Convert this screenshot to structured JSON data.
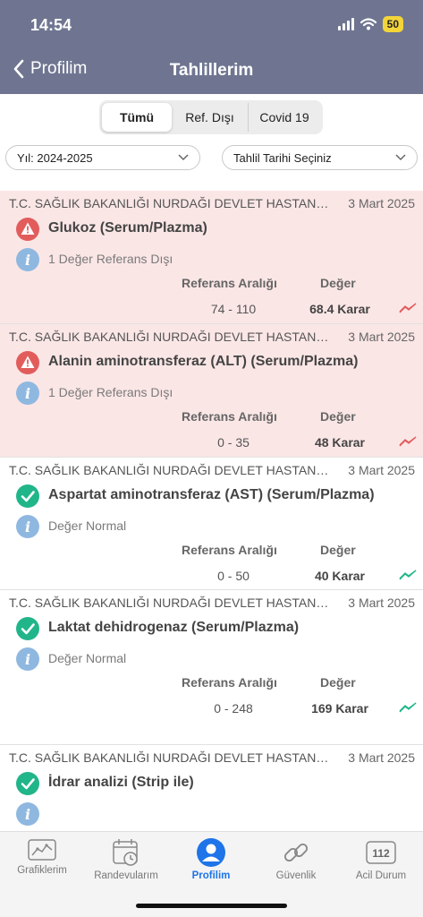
{
  "status_bar": {
    "time": "14:54",
    "battery": "50"
  },
  "nav": {
    "back_label": "Profilim",
    "title": "Tahlillerim"
  },
  "segments": [
    {
      "label": "Tümü",
      "active": true
    },
    {
      "label": "Ref. Dışı",
      "active": false
    },
    {
      "label": "Covid 19",
      "active": false
    }
  ],
  "filters": {
    "year": "Yıl: 2024-2025",
    "date": "Tahlil Tarihi Seçiniz"
  },
  "columns": {
    "ref": "Referans Aralığı",
    "value": "Değer"
  },
  "results": [
    {
      "hospital": "T.C. SAĞLIK BAKANLIĞI NURDAĞI DEVLET HASTANESİ",
      "date": "3 Mart 2025",
      "name": "Glukoz (Serum/Plazma)",
      "note": "1 Değer Referans Dışı",
      "ref_range": "74 - 110",
      "value": "68.4 Karar",
      "status": "out"
    },
    {
      "hospital": "T.C. SAĞLIK BAKANLIĞI NURDAĞI DEVLET HASTANESİ",
      "date": "3 Mart 2025",
      "name": "Alanin aminotransferaz (ALT) (Serum/Plazma)",
      "note": "1 Değer Referans Dışı",
      "ref_range": "0 - 35",
      "value": "48 Karar",
      "status": "out"
    },
    {
      "hospital": "T.C. SAĞLIK BAKANLIĞI NURDAĞI DEVLET HASTANESİ",
      "date": "3 Mart 2025",
      "name": "Aspartat aminotransferaz (AST) (Serum/Plazma)",
      "note": "Değer Normal",
      "ref_range": "0 - 50",
      "value": "40 Karar",
      "status": "normal"
    },
    {
      "hospital": "T.C. SAĞLIK BAKANLIĞI NURDAĞI DEVLET HASTANESİ",
      "date": "3 Mart 2025",
      "name": "Laktat dehidrogenaz (Serum/Plazma)",
      "note": "Değer Normal",
      "ref_range": "0 - 248",
      "value": "169 Karar",
      "status": "normal"
    },
    {
      "hospital": "T.C. SAĞLIK BAKANLIĞI NURDAĞI DEVLET HASTANESİ",
      "date": "3 Mart 2025",
      "name": "İdrar analizi (Strip ile)",
      "status": "normal"
    }
  ],
  "tabbar": [
    {
      "label": "Grafiklerim",
      "icon": "chart-icon"
    },
    {
      "label": "Randevularım",
      "icon": "calendar-icon"
    },
    {
      "label": "Profilim",
      "icon": "profile-icon",
      "active": true
    },
    {
      "label": "Güvenlik",
      "icon": "link-icon"
    },
    {
      "label": "Acil Durum",
      "icon": "emergency-112-icon",
      "badge": "112"
    }
  ],
  "colors": {
    "header": "#6f7591",
    "out_of_range_bg": "#fbe6e6",
    "alert": "#e25c5c",
    "ok": "#21b58a",
    "info": "#8fb8e0",
    "active_tab": "#1e74e8"
  }
}
